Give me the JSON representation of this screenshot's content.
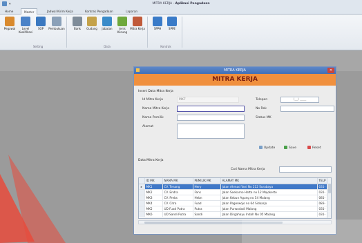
{
  "window": {
    "title_prefix": "MITRA KERJA",
    "title_app": "Aplikasi Pengadaan"
  },
  "tabs": [
    {
      "label": "Home"
    },
    {
      "label": "Master"
    },
    {
      "label": "Jadwal Kirim Kerja"
    },
    {
      "label": "Kontrak Pengadaan"
    },
    {
      "label": "Laporan"
    }
  ],
  "ribbon": {
    "buttons": [
      {
        "label": "Pegawai",
        "icon": "pegawai-icon",
        "color": "#d98a2e"
      },
      {
        "label": "Level Kualifikasi",
        "icon": "level-icon",
        "color": "#4a82c8"
      },
      {
        "label": "SOP",
        "icon": "sop-icon",
        "color": "#3a78c0"
      },
      {
        "label": "Pembukuan",
        "icon": "pembukuan-icon",
        "color": "#8aa0b8"
      },
      {
        "label": "Bank",
        "icon": "bank-icon",
        "color": "#7f8c99"
      },
      {
        "label": "Gudang",
        "icon": "gudang-icon",
        "color": "#c4a24a"
      },
      {
        "label": "Jabatan",
        "icon": "jabatan-icon",
        "color": "#3a8bc9"
      },
      {
        "label": "Jenis Kerung",
        "icon": "jenis-icon",
        "color": "#6ea83c"
      },
      {
        "label": "Mitra Kerja",
        "icon": "mitra-icon",
        "color": "#c05a3a"
      },
      {
        "label": "SPPH",
        "icon": "spph-icon",
        "color": "#3a7bc8"
      },
      {
        "label": "SPPE",
        "icon": "sppe-icon",
        "color": "#3a7bc8"
      }
    ],
    "groups": [
      "Setting",
      "Data",
      "Kontrak"
    ]
  },
  "dialog": {
    "title": "MITRA KERJA",
    "header": "MITRA KERJA",
    "form_section": "Insert Data Mitra Kerja",
    "labels": {
      "id": "Id Mitra Kerja",
      "nama": "Nama Mitra Kerja",
      "pemilik": "Nama Pemilik",
      "alamat": "Alamat",
      "telepon": "Telepon",
      "norek": "No Rek",
      "status": "Status MK"
    },
    "values": {
      "id": "MK7",
      "telepon": "(__) ____"
    },
    "buttons": {
      "update": "Update",
      "save": "Save",
      "reset": "Reset"
    },
    "grid_section": "Data Mitra Kerja",
    "search_label": "Cari Nama Mitra Kerja",
    "columns": [
      "ID MK",
      "NAMA MK",
      "PEMILIK MK",
      "ALAMAT MK",
      "TELP"
    ],
    "rows": [
      [
        "MK1",
        "CV. Tenang",
        "Hery",
        "Jalan Ahmad Yani No 212 Surabaya",
        "031-"
      ],
      [
        "MK2",
        "CV. Endra",
        "Fans",
        "Jalan Soekarno Hatta no 12 Mojokerto",
        "031-"
      ],
      [
        "MK3",
        "CV. Prebs",
        "Hebn",
        "Jalan Kebun Agung no 54 Malang",
        "081-"
      ],
      [
        "MK4",
        "CV. Citra",
        "Fuad",
        "Jalan Pagerwojo no 64 Sidoarjo",
        "083-"
      ],
      [
        "MK5",
        "UD Fuad Putra",
        "Putra",
        "Jalan Purwodadi Malang",
        "031-"
      ],
      [
        "MK6",
        "UD Sandi Putra",
        "Sandi",
        "Jalan Dirgahayu Indah No 05 Malang",
        "031-"
      ]
    ]
  }
}
